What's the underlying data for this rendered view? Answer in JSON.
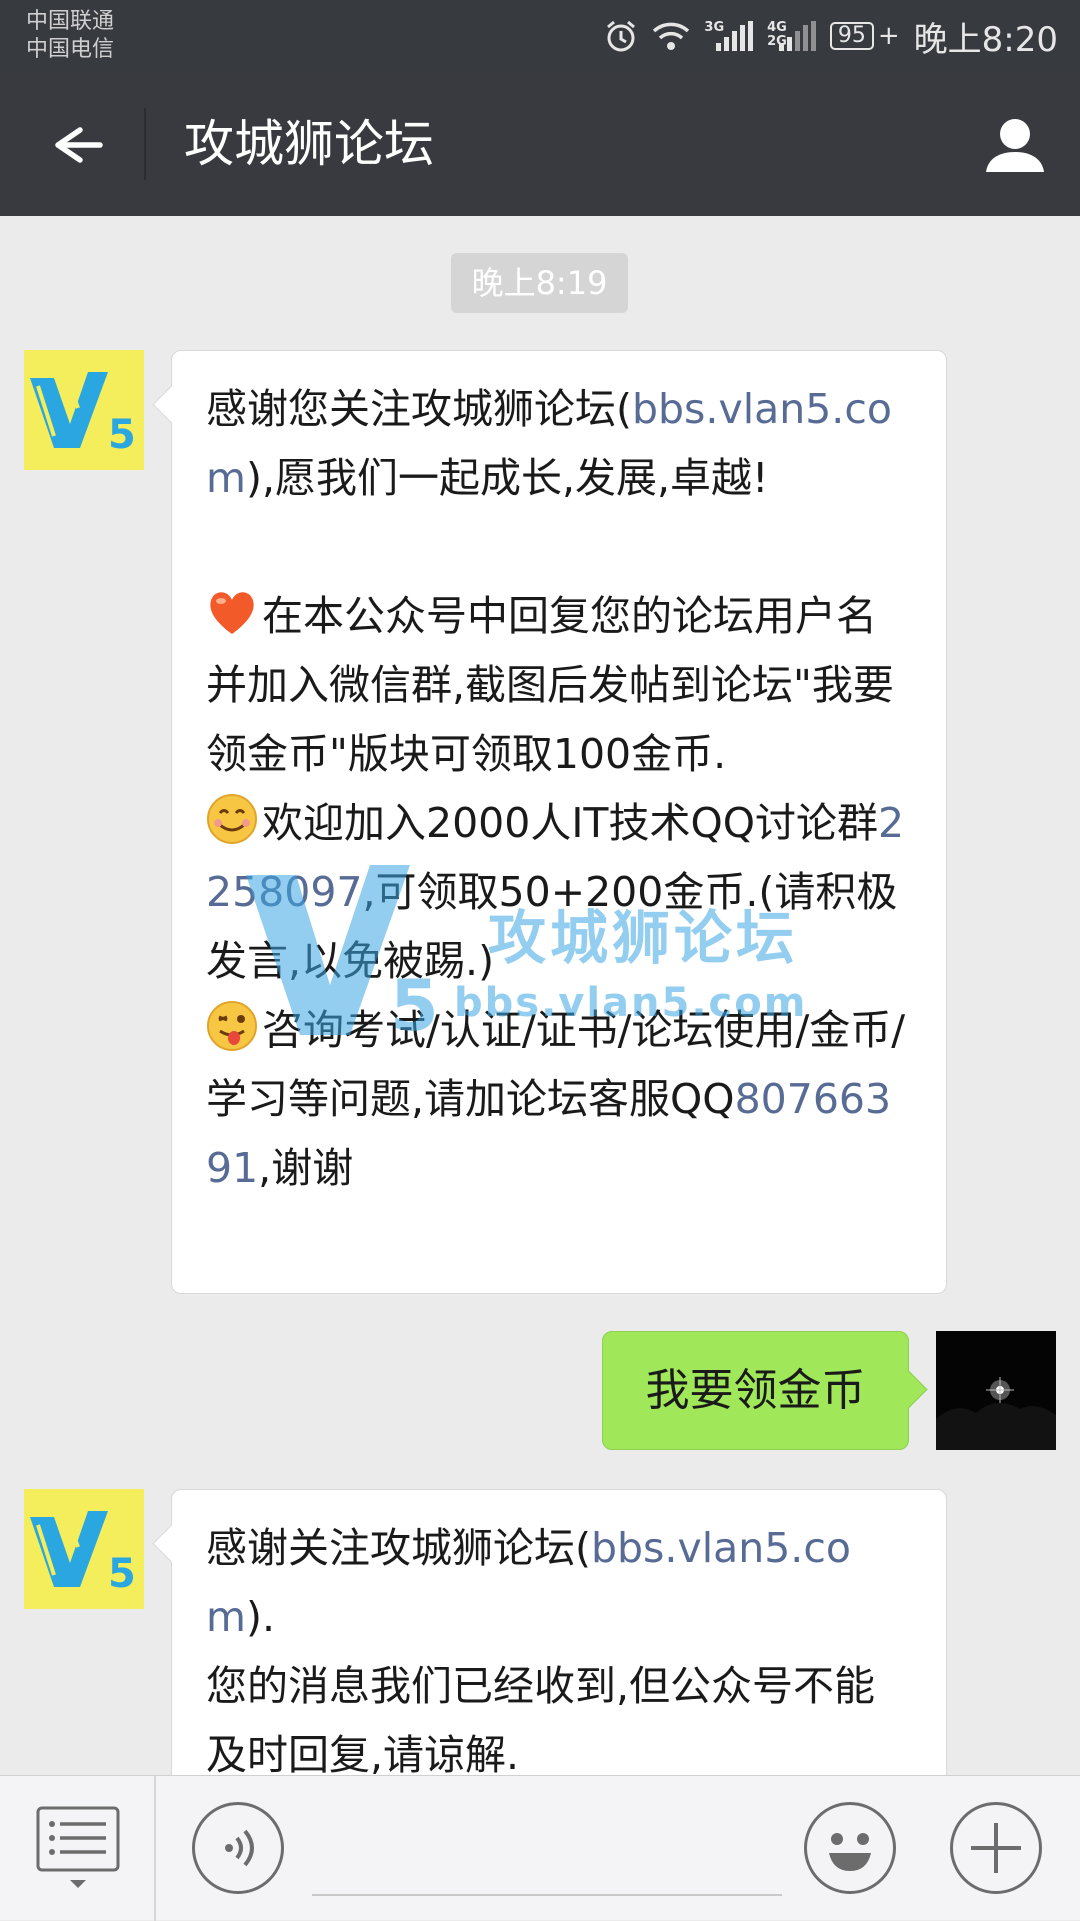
{
  "status_bar": {
    "carrier_1": "中国联通",
    "carrier_2": "中国电信",
    "net_3g": "3G",
    "net_4g": "4G",
    "net_2g": "2G",
    "battery": "95",
    "time": "晚上8:20"
  },
  "header": {
    "title": "攻城狮论坛",
    "back_icon": "arrow-left-icon",
    "profile_icon": "person-icon"
  },
  "chat": {
    "time_divider": "晚上8:19",
    "messages": [
      {
        "sender": "bot",
        "avatar_text": "V5",
        "p1_prefix": "感谢您关注攻城狮论坛(",
        "p1_link": "bbs.vlan5.com",
        "p1_suffix": "),愿我们一起成长,发展,卓越!",
        "p2_emoji": "heart",
        "p2_text": "在本公众号中回复您的论坛用户名并加入微信群,截图后发帖到论坛\"我要领金币\"版块可领取100金币.",
        "p3_emoji": "smile",
        "p3_prefix": "欢迎加入2000人IT技术QQ讨论群",
        "p3_link": "2258097",
        "p3_suffix": ",可领取50+200金币.(请积极发言,以免被踢.)",
        "p4_emoji": "wink-tongue",
        "p4_text": "咨询考试/认证/证书/论坛使用/金币/学习等问题,请加论坛客服QQ",
        "p4_link": "80766391",
        "p4_suffix": ",谢谢"
      },
      {
        "sender": "me",
        "text": "我要领金币"
      },
      {
        "sender": "bot",
        "avatar_text": "V5",
        "p1_prefix": "感谢关注攻城狮论坛(",
        "p1_link": "bbs.vlan5.com",
        "p1_suffix": ").",
        "p2_text": "您的消息我们已经收到,但公众号不能及时回复,请谅解."
      }
    ]
  },
  "watermark": {
    "title": "攻城狮论坛",
    "url": "bbs.vlan5.com",
    "logo": "V5"
  },
  "input_bar": {
    "menu_icon": "menu-list-icon",
    "voice_icon": "voice-icon",
    "emoji_icon": "emoji-icon",
    "plus_icon": "plus-icon"
  },
  "colors": {
    "header_bg": "#393a3f",
    "chat_bg": "#ebebeb",
    "link": "#576b95",
    "my_bubble": "#a0e75a"
  }
}
